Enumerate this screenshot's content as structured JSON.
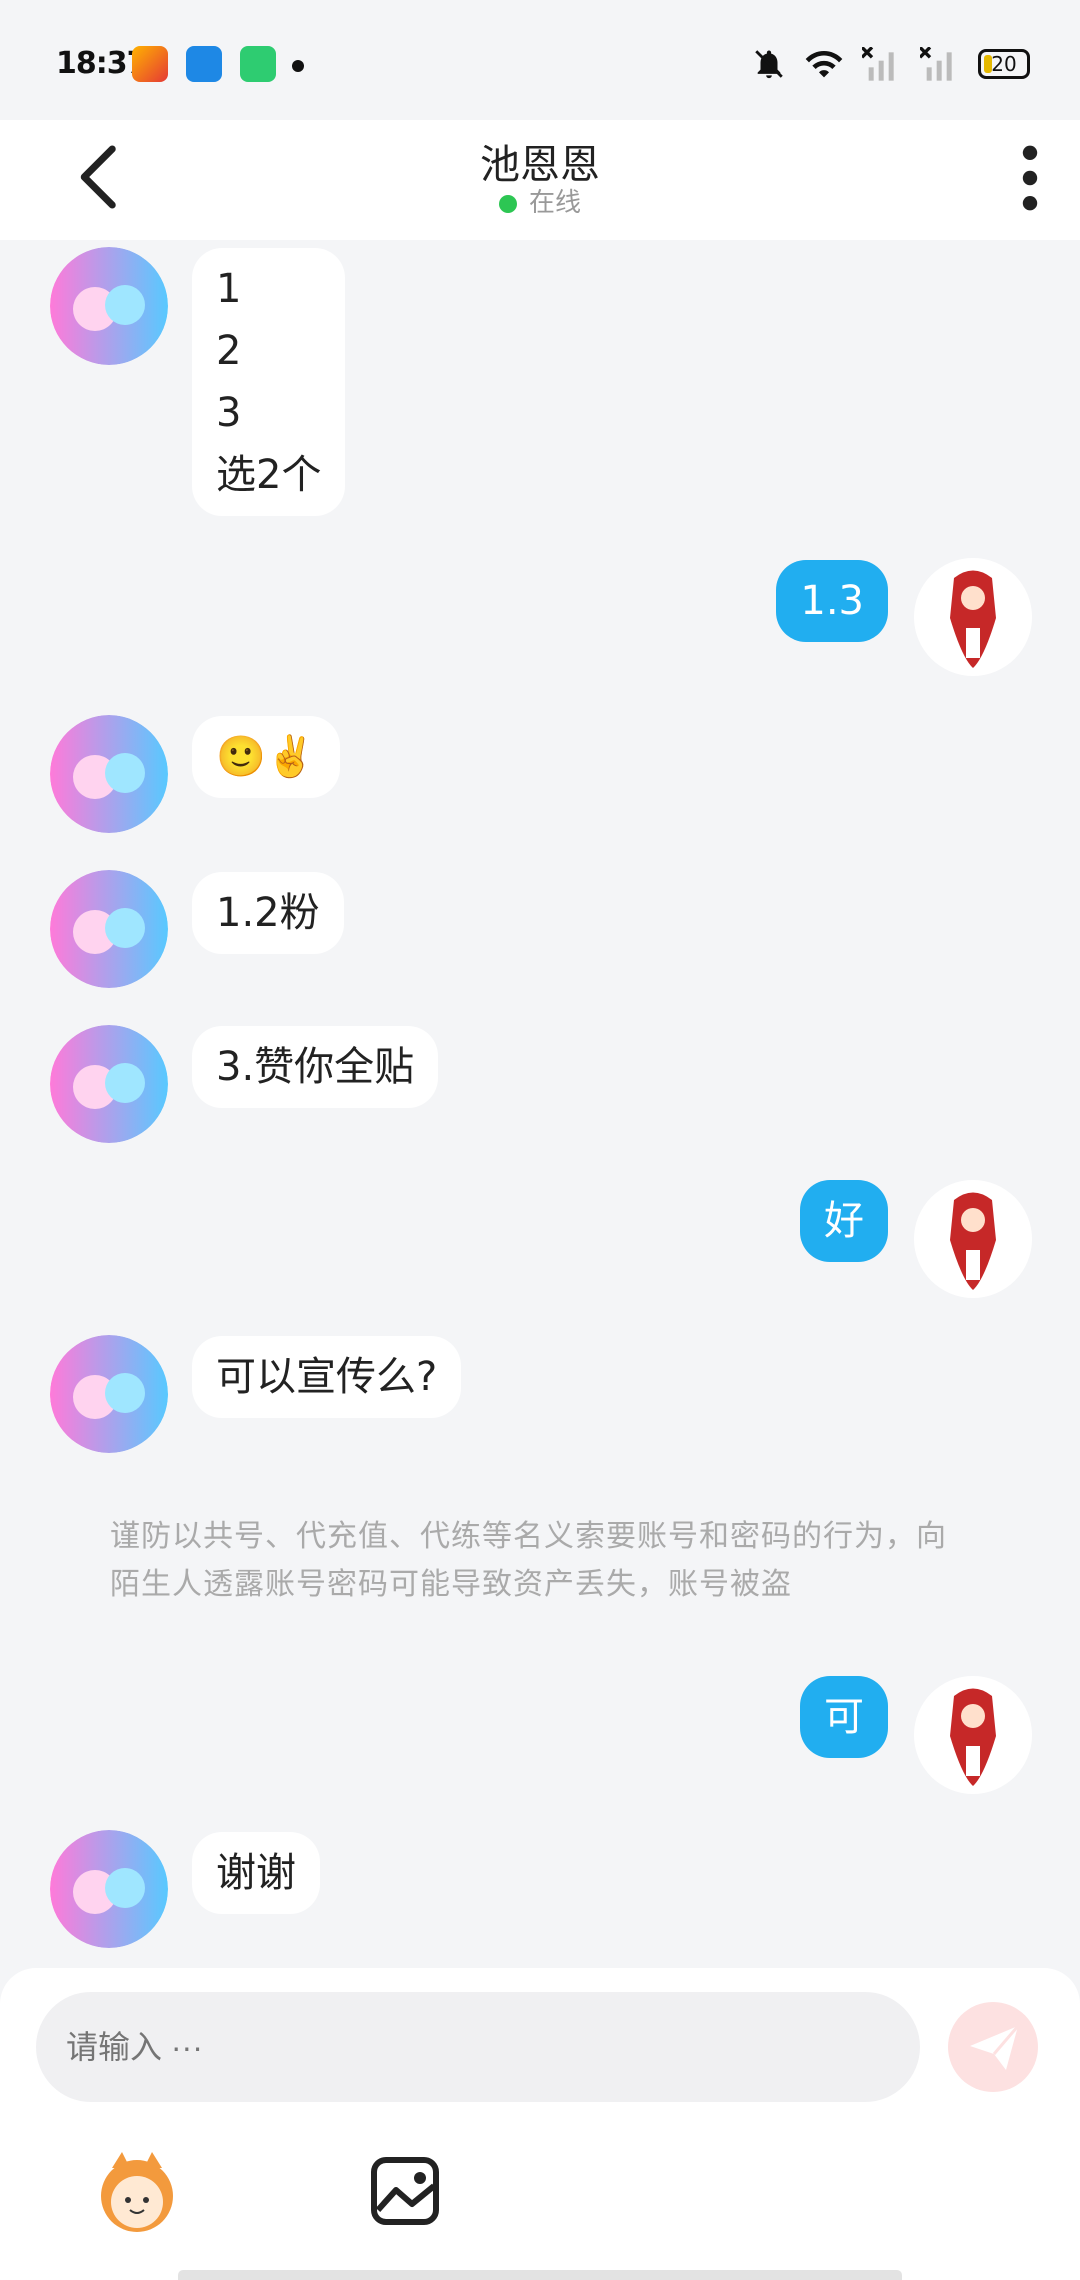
{
  "status": {
    "time": "18:37",
    "battery": "20"
  },
  "header": {
    "title": "池恩恩",
    "online": "在线"
  },
  "messages": [
    {
      "side": "left",
      "text": "1\n2\n3\n选2个"
    },
    {
      "side": "right",
      "text": "1.3"
    },
    {
      "side": "left",
      "text": "🙂✌️"
    },
    {
      "side": "left",
      "text": "1.2粉"
    },
    {
      "side": "left",
      "text": "3.赞你全贴"
    },
    {
      "side": "right",
      "text": "好"
    },
    {
      "side": "left",
      "text": "可以宣传么?"
    },
    {
      "side": "right",
      "text": "可"
    },
    {
      "side": "left",
      "text": "谢谢"
    }
  ],
  "notice": "谨防以共号、代充值、代练等名义索要账号和密码的行为，向陌生人透露账号密码可能导致资产丢失，账号被盗",
  "composer": {
    "placeholder": "请输入 ···"
  }
}
